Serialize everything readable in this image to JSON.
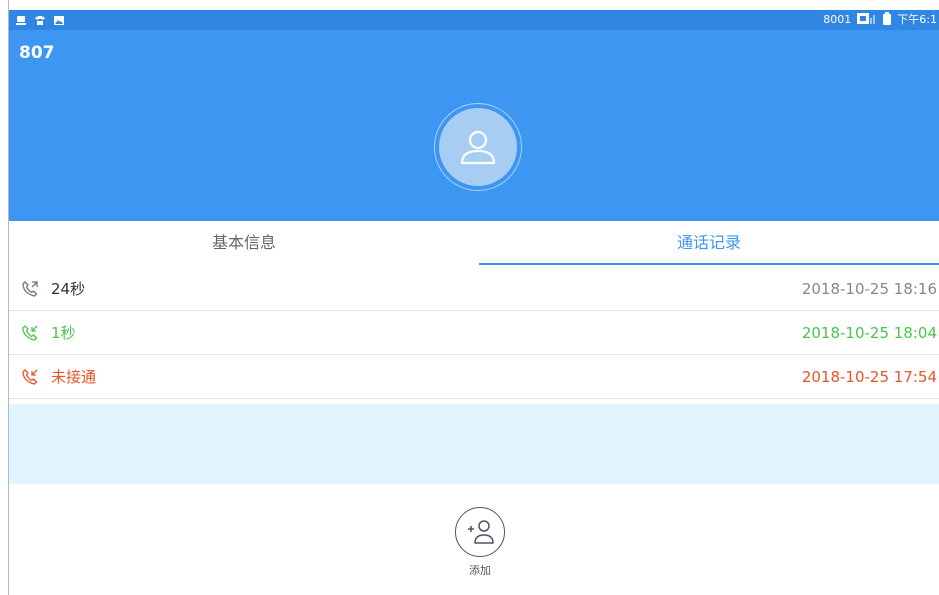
{
  "status_bar": {
    "left_icons": [
      "usb-icon",
      "phone-icon",
      "image-icon"
    ],
    "extension": "8001",
    "time": "下午6:1",
    "right_icons": [
      "network-icon",
      "battery-icon"
    ]
  },
  "header": {
    "contact_name": "807",
    "avatar_icon": "person-icon",
    "color": "#3d97f2"
  },
  "tabs": [
    {
      "label": "基本信息",
      "selected": false
    },
    {
      "label": "通话记录",
      "selected": true
    }
  ],
  "calls": [
    {
      "type": "outgoing",
      "duration": "24秒",
      "time": "2018-10-25 18:16",
      "color": "#333333",
      "time_color": "#888888"
    },
    {
      "type": "incoming",
      "duration": "1秒",
      "time": "2018-10-25 18:04",
      "color": "#4cc44c",
      "time_color": "#4cc44c"
    },
    {
      "type": "missed",
      "duration": "未接通",
      "time": "2018-10-25 17:54",
      "color": "#e5552a",
      "time_color": "#e5552a"
    }
  ],
  "add_button": {
    "label": "添加",
    "icon": "add-contact-icon"
  }
}
